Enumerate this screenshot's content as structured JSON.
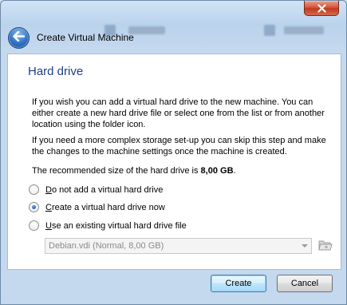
{
  "window": {
    "title": "Create Virtual Machine",
    "close_glyph": "✕"
  },
  "icons": {
    "back": "back-arrow-icon",
    "close": "close-icon",
    "folder": "folder-icon",
    "dropdown": "chevron-down-icon"
  },
  "page": {
    "heading": "Hard drive",
    "para1": "If you wish you can add a virtual hard drive to the new machine. You can either create a new hard drive file or select one from the list or from another location using the folder icon.",
    "para2": "If you need a more complex storage set-up you can skip this step and make the changes to the machine settings once the machine is created.",
    "recommended_prefix": "The recommended size of the hard drive is ",
    "recommended_size": "8,00 GB",
    "recommended_suffix": "."
  },
  "options": [
    {
      "label_accel": "D",
      "label_rest": "o not add a virtual hard drive",
      "checked": false
    },
    {
      "label_accel": "C",
      "label_rest": "reate a virtual hard drive now",
      "checked": true
    },
    {
      "label_accel": "U",
      "label_rest": "se an existing virtual hard drive file",
      "checked": false
    }
  ],
  "existing_file": {
    "selected": "Debian.vdi (Normal, 8,00 GB)",
    "enabled": false
  },
  "buttons": {
    "create": "Create",
    "cancel": "Cancel"
  },
  "colors": {
    "heading": "#1f3d8a",
    "accent": "#2e72c4"
  }
}
